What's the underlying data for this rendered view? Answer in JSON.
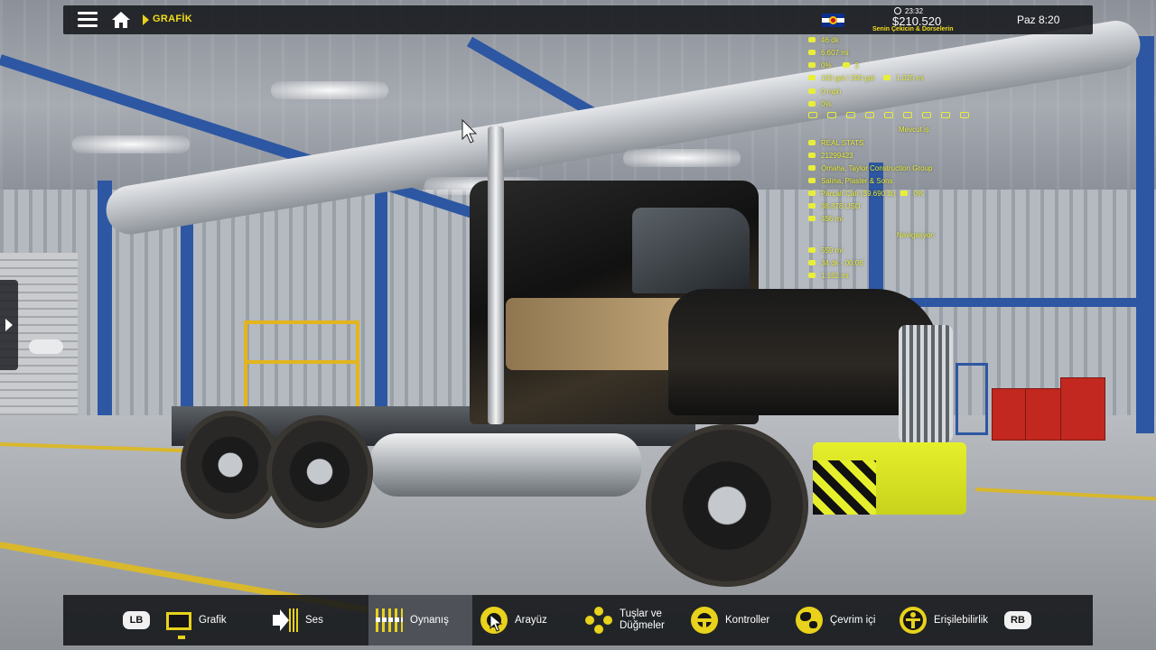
{
  "topbar": {
    "section": "GRAFİK",
    "flag_icon": "colorado-flag-icon",
    "time_mini": "23:32",
    "money": "$210.520",
    "money_caption": "Senin Çekicin & Dorselerin",
    "day_time": "Paz 8:20"
  },
  "hud": {
    "truck_stats": [
      "46 dk",
      "6.607 mi",
      "0%",
      "2",
      "193 gal / 200 gal",
      "1.025 mi",
      "0 mph",
      "0%",
      "Mevcut iş"
    ],
    "job_stats": [
      "REAL STATS",
      "21299423",
      "Omaha, Taylor Construction Group",
      "Salina, Plaster & Sons",
      "Parçalı Çatı (39.690 lb)",
      "0%",
      "38.878 USD",
      "456 mi",
      "Navigasyon",
      "559 mi",
      "34 dk - 00:06",
      "1.162 mi"
    ]
  },
  "bottombar": {
    "lb": "LB",
    "rb": "RB",
    "items": [
      {
        "label": "Grafik",
        "icon": "monitor-icon"
      },
      {
        "label": "Ses",
        "icon": "speaker-icon"
      },
      {
        "label": "Oynanış",
        "icon": "sliders-icon"
      },
      {
        "label": "Arayüz",
        "icon": "cursor-icon"
      },
      {
        "label": "Tuşlar ve",
        "label2": "Düğmeler",
        "icon": "buttons-icon"
      },
      {
        "label": "Kontroller",
        "icon": "steering-wheel-icon"
      },
      {
        "label": "Çevrim içi",
        "icon": "globe-icon"
      },
      {
        "label": "Erişilebilirlik",
        "icon": "accessibility-icon"
      }
    ],
    "active_item": "Oynanış"
  },
  "colors": {
    "accent_yellow": "#e8d21c",
    "hud_yellow": "#e9ef37",
    "bar_bg": "#16181c",
    "active_bg": "#4e5258"
  }
}
